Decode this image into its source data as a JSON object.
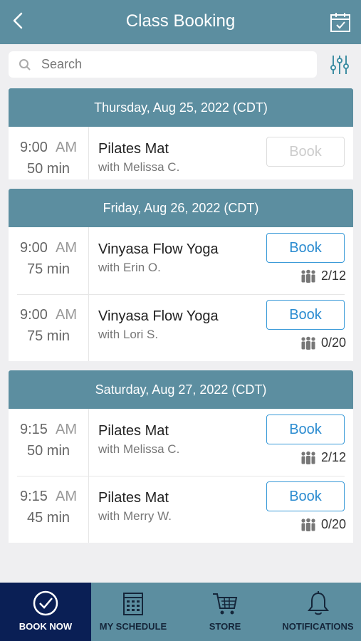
{
  "header": {
    "title": "Class Booking",
    "back_icon": "chevron-left-icon",
    "calendar_icon": "calendar-check-icon"
  },
  "search": {
    "placeholder": "Search",
    "icon": "search-icon",
    "filter_icon": "sliders-icon"
  },
  "days": [
    {
      "date": "Thursday, Aug 25, 2022 (CDT)",
      "classes": [
        {
          "time": "9:00",
          "ampm": "AM",
          "duration": "50 min",
          "name": "Pilates Mat",
          "instructor": "with Melissa C.",
          "book_label": "Book",
          "bookable": false,
          "capacity": ""
        }
      ]
    },
    {
      "date": "Friday, Aug 26, 2022 (CDT)",
      "classes": [
        {
          "time": "9:00",
          "ampm": "AM",
          "duration": "75 min",
          "name": "Vinyasa Flow Yoga",
          "instructor": "with Erin O.",
          "book_label": "Book",
          "bookable": true,
          "capacity": "2/12"
        },
        {
          "time": "9:00",
          "ampm": "AM",
          "duration": "75 min",
          "name": "Vinyasa Flow Yoga",
          "instructor": "with Lori S.",
          "book_label": "Book",
          "bookable": true,
          "capacity": "0/20"
        }
      ]
    },
    {
      "date": "Saturday, Aug 27, 2022 (CDT)",
      "classes": [
        {
          "time": "9:15",
          "ampm": "AM",
          "duration": "50 min",
          "name": "Pilates Mat",
          "instructor": "with Melissa C.",
          "book_label": "Book",
          "bookable": true,
          "capacity": "2/12"
        },
        {
          "time": "9:15",
          "ampm": "AM",
          "duration": "45 min",
          "name": "Pilates Mat",
          "instructor": "with Merry W.",
          "book_label": "Book",
          "bookable": true,
          "capacity": "0/20"
        }
      ]
    }
  ],
  "tabs": [
    {
      "label": "BOOK NOW",
      "icon": "check-circle-icon",
      "active": true
    },
    {
      "label": "MY SCHEDULE",
      "icon": "schedule-icon",
      "active": false
    },
    {
      "label": "STORE",
      "icon": "cart-icon",
      "active": false
    },
    {
      "label": "NOTIFICATIONS",
      "icon": "bell-icon",
      "active": false
    }
  ],
  "colors": {
    "primary": "#5c8ea0",
    "active_tab": "#0a1f55",
    "book_blue": "#2a8bd0",
    "background": "#efeff1"
  }
}
